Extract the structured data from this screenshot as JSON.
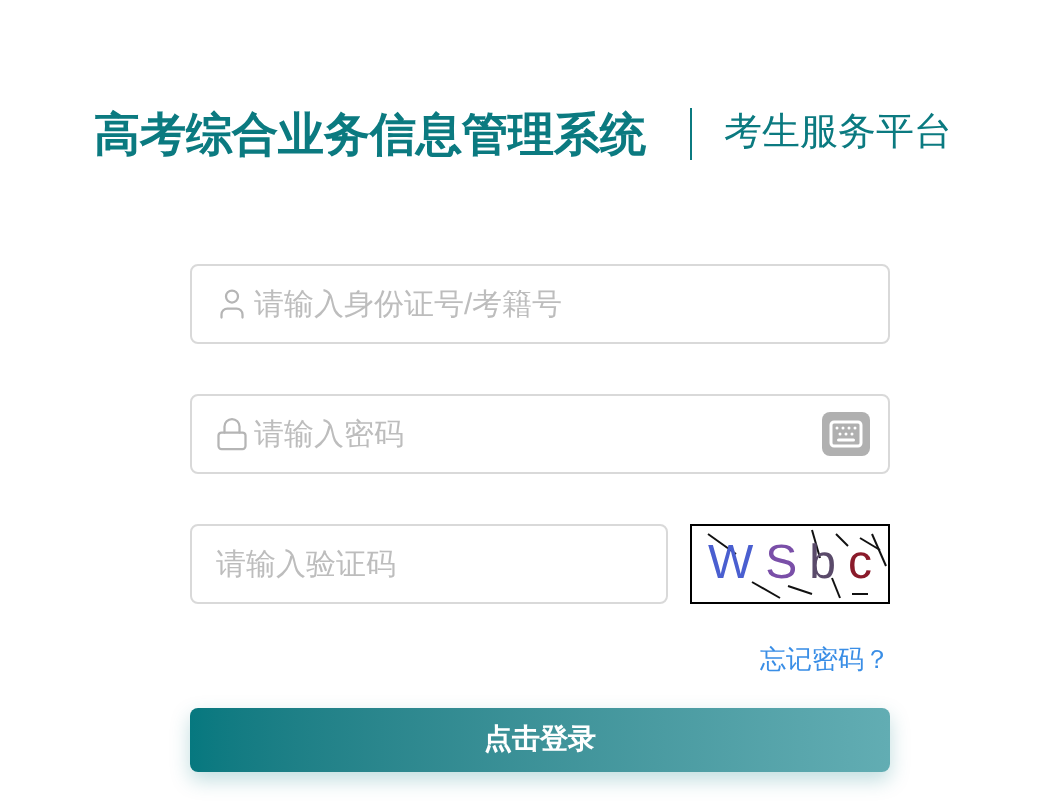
{
  "header": {
    "title": "高考综合业务信息管理系统",
    "subtitle": "考生服务平台"
  },
  "fields": [
    {
      "kind": "user",
      "placeholder": "请输入身份证号/考籍号"
    },
    {
      "kind": "password",
      "placeholder": "请输入密码"
    }
  ],
  "captcha": {
    "placeholder": "请输入验证码",
    "chars": [
      {
        "text": "W",
        "color": "#4a5fd0"
      },
      {
        "text": "S",
        "color": "#7a4fa8"
      },
      {
        "text": "b",
        "color": "#5a4a6a"
      },
      {
        "text": "c",
        "color": "#8a1a2a"
      }
    ]
  },
  "forgot_link": "忘记密码？",
  "login_button": "点击登录"
}
